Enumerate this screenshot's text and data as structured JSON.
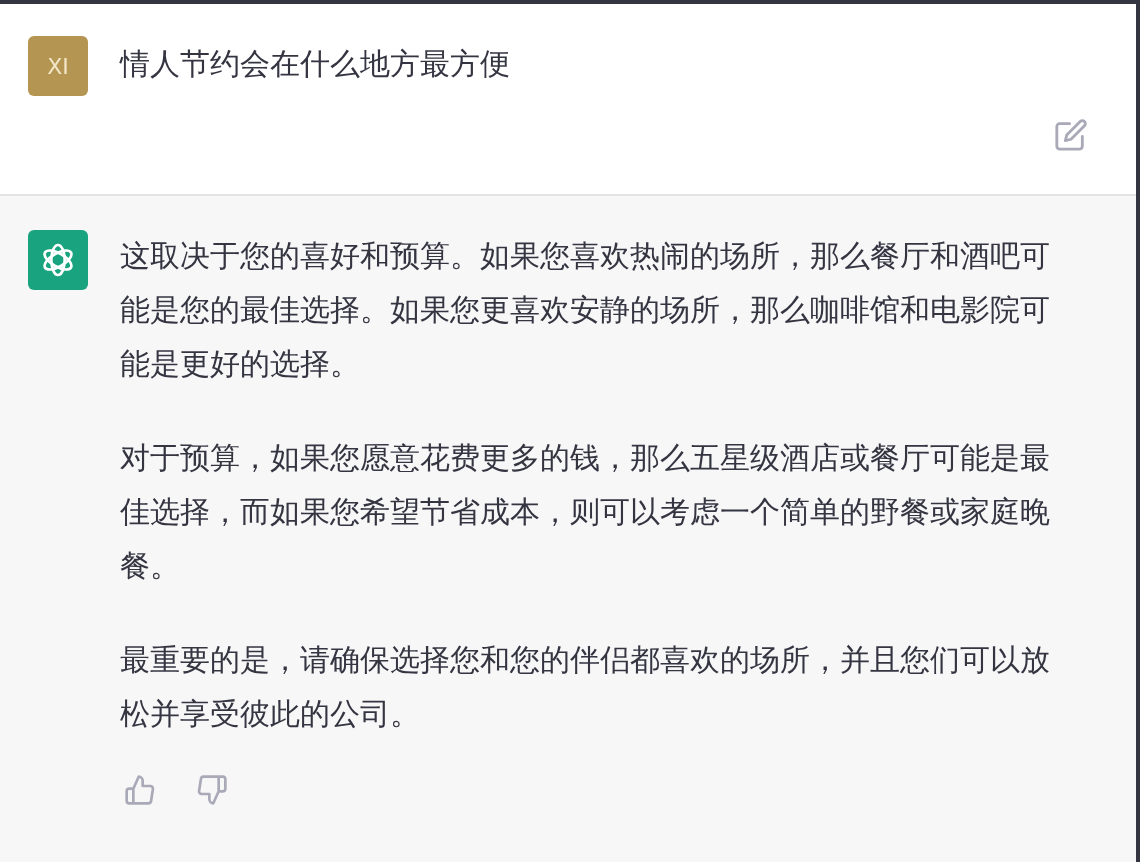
{
  "user_message": {
    "avatar": "XI",
    "text": "情人节约会在什么地方最方便"
  },
  "assistant_message": {
    "paragraphs": [
      "这取决于您的喜好和预算。如果您喜欢热闹的场所，那么餐厅和酒吧可能是您的最佳选择。如果您更喜欢安静的场所，那么咖啡馆和电影院可能是更好的选择。",
      "对于预算，如果您愿意花费更多的钱，那么五星级酒店或餐厅可能是最佳选择，而如果您希望节省成本，则可以考虑一个简单的野餐或家庭晚餐。",
      "最重要的是，请确保选择您和您的伴侣都喜欢的场所，并且您们可以放松并享受彼此的公司。"
    ]
  }
}
